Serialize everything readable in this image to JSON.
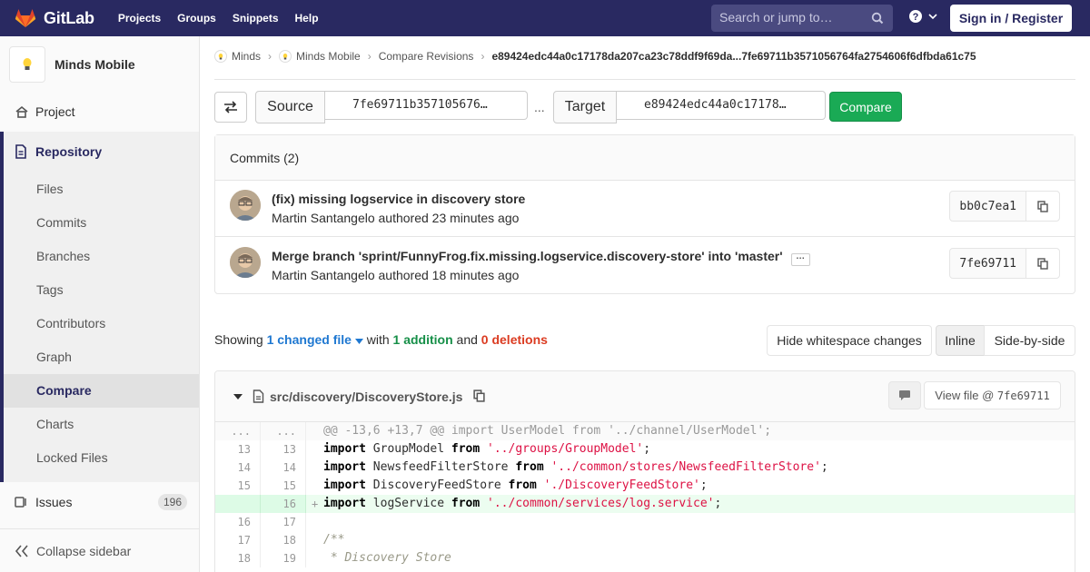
{
  "navbar": {
    "brand": "GitLab",
    "links": [
      "Projects",
      "Groups",
      "Snippets",
      "Help"
    ],
    "search_placeholder": "Search or jump to…",
    "signin_label": "Sign in / Register"
  },
  "sidebar": {
    "project_name": "Minds Mobile",
    "project": "Project",
    "repository": "Repository",
    "repo_items": [
      "Files",
      "Commits",
      "Branches",
      "Tags",
      "Contributors",
      "Graph",
      "Compare",
      "Charts",
      "Locked Files"
    ],
    "issues": "Issues",
    "issues_count": "196",
    "collapse": "Collapse sidebar"
  },
  "breadcrumb": {
    "items": [
      "Minds",
      "Minds Mobile",
      "Compare Revisions"
    ],
    "current": "e89424edc44a0c17178da207ca23c78ddf9f69da...7fe69711b3571056764fa2754606f6dfbda61c75"
  },
  "compare": {
    "source_label": "Source",
    "source_value": "7fe69711b357105676…",
    "dots": "...",
    "target_label": "Target",
    "target_value": "e89424edc44a0c17178…",
    "button": "Compare"
  },
  "commits": {
    "header": "Commits (2)",
    "items": [
      {
        "title": "(fix) missing logservice in discovery store",
        "meta": "Martin Santangelo authored 23 minutes ago",
        "sha": "bb0c7ea1"
      },
      {
        "title": "Merge branch 'sprint/FunnyFrog.fix.missing.logservice.discovery-store' into 'master'",
        "meta": "Martin Santangelo authored 18 minutes ago",
        "sha": "7fe69711"
      }
    ]
  },
  "summary": {
    "showing": "Showing",
    "changed": "1 changed file",
    "with": "with",
    "additions": "1 addition",
    "and": "and",
    "deletions": "0 deletions",
    "hide_ws": "Hide whitespace changes",
    "inline": "Inline",
    "side": "Side-by-side"
  },
  "diff": {
    "file_path": "src/discovery/DiscoveryStore.js",
    "view_file": "View file @",
    "view_sha": "7fe69711",
    "hunk_old": "...",
    "hunk_new": "...",
    "hunk": "@@ -13,6 +13,7 @@ import UserModel from '../channel/UserModel';",
    "lines": [
      {
        "old": "13",
        "new": "13",
        "kw1": "import",
        "name": " GroupModel ",
        "kw2": "from",
        "str": "'../groups/GroupModel'",
        "end": ";"
      },
      {
        "old": "14",
        "new": "14",
        "kw1": "import",
        "name": " NewsfeedFilterStore ",
        "kw2": "from",
        "str": "'../common/stores/NewsfeedFilterStore'",
        "end": ";"
      },
      {
        "old": "15",
        "new": "15",
        "kw1": "import",
        "name": " DiscoveryFeedStore ",
        "kw2": "from",
        "str": "'./DiscoveryFeedStore'",
        "end": ";"
      },
      {
        "old": "",
        "new": "16",
        "plus": "+",
        "kw1": "import",
        "name": " logService ",
        "kw2": "from",
        "str": "'../common/services/log.service'",
        "end": ";"
      }
    ],
    "tail": [
      {
        "old": "16",
        "new": "17",
        "text": ""
      },
      {
        "old": "17",
        "new": "18",
        "text": "/**"
      },
      {
        "old": "18",
        "new": "19",
        "text": " * Discovery Store"
      }
    ]
  }
}
